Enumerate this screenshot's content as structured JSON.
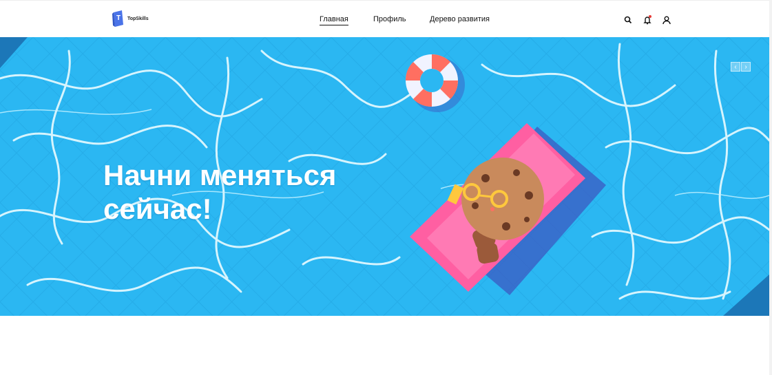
{
  "brand": {
    "name": "TopSkills",
    "color": "#4a73e8"
  },
  "nav": {
    "items": [
      {
        "label": "Главная",
        "active": true
      },
      {
        "label": "Профиль",
        "active": false
      },
      {
        "label": "Дерево развития",
        "active": false
      }
    ]
  },
  "header_icons": [
    "search-icon",
    "bell-icon",
    "user-icon"
  ],
  "hero": {
    "title_line1": "Начни меняться",
    "title_line2": "сейчас!",
    "prev_label": "‹",
    "next_label": "›",
    "bg_color": "#27b4f0"
  }
}
